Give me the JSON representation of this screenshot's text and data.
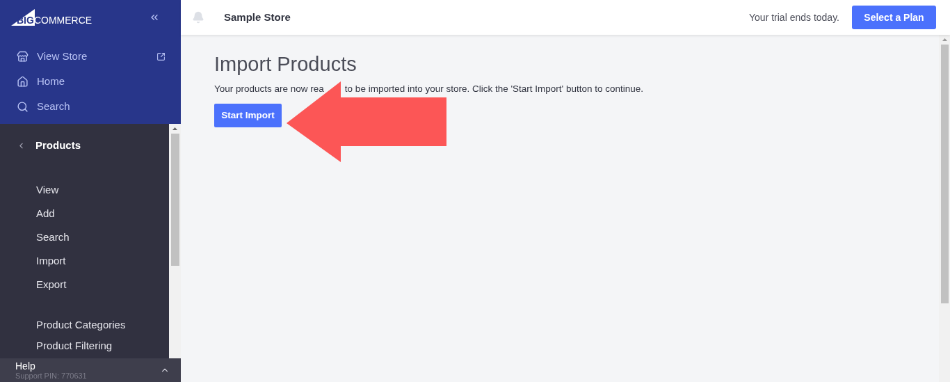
{
  "sidebar": {
    "logo": {
      "big": "BIG",
      "commerce": "COMMERCE"
    },
    "top_items": [
      {
        "label": "View Store",
        "external": true
      },
      {
        "label": "Home",
        "external": false
      },
      {
        "label": "Search",
        "external": false
      }
    ],
    "section": {
      "title": "Products",
      "groups": [
        [
          "View",
          "Add",
          "Search",
          "Import",
          "Export"
        ],
        [
          "Product Categories",
          "Product Filtering"
        ]
      ]
    },
    "help": {
      "title": "Help",
      "pin": "Support PIN: 770631"
    }
  },
  "header": {
    "store_name": "Sample Store",
    "trial_text": "Your trial ends today.",
    "plan_button": "Select a Plan"
  },
  "page": {
    "title": "Import Products",
    "message_parts": [
      "Your products are now rea",
      "to be imported into your store. Click the 'Start Import' button to continue."
    ],
    "button": "Start Import"
  }
}
